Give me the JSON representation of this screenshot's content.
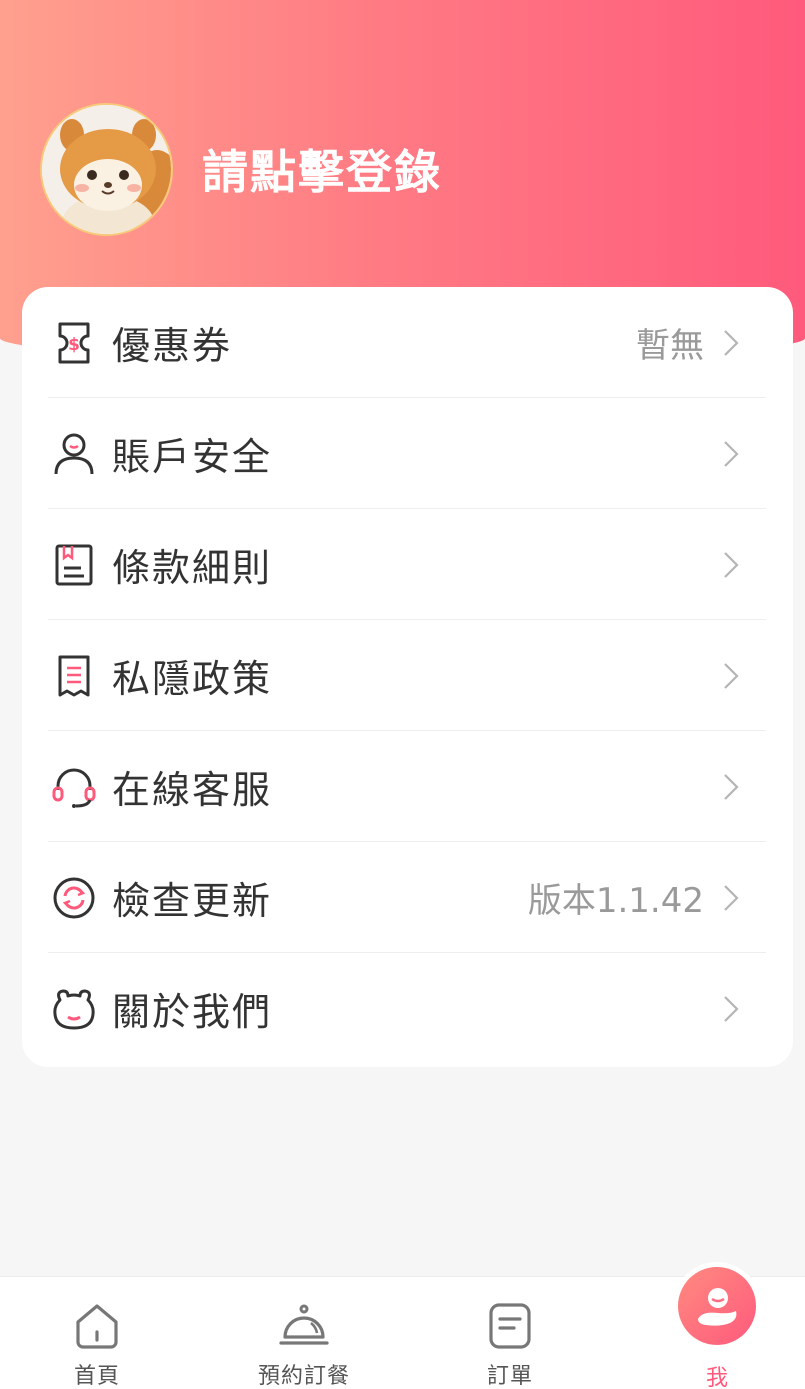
{
  "header": {
    "login_prompt": "請點擊登錄",
    "avatar": "squirrel-mascot-avatar"
  },
  "menu": {
    "items": [
      {
        "label": "優惠券",
        "value": "暫無",
        "icon": "coupon-icon"
      },
      {
        "label": "賬戶安全",
        "value": "",
        "icon": "user-icon"
      },
      {
        "label": "條款細則",
        "value": "",
        "icon": "terms-icon"
      },
      {
        "label": "私隱政策",
        "value": "",
        "icon": "privacy-icon"
      },
      {
        "label": "在線客服",
        "value": "",
        "icon": "headset-icon"
      },
      {
        "label": "檢查更新",
        "value": "版本1.1.42",
        "icon": "refresh-icon"
      },
      {
        "label": "關於我們",
        "value": "",
        "icon": "mascot-face-icon"
      }
    ]
  },
  "tabbar": {
    "tabs": [
      {
        "label": "首頁",
        "icon": "home-icon"
      },
      {
        "label": "預約訂餐",
        "icon": "service-bell-icon"
      },
      {
        "label": "訂單",
        "icon": "order-icon"
      },
      {
        "label": "我",
        "icon": "profile-icon",
        "active": true
      }
    ]
  },
  "colors": {
    "accent": "#ff5a7c",
    "header_start": "#ffa08e",
    "header_end": "#ff5a7c",
    "icon_pink": "#ff6b8a"
  }
}
